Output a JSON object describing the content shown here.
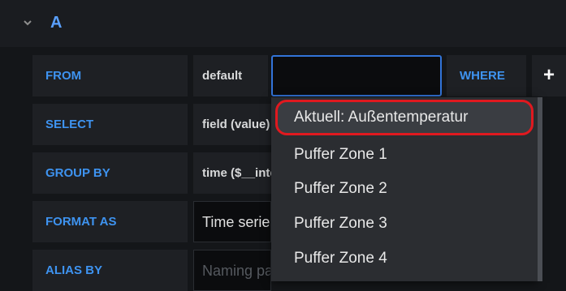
{
  "query": {
    "letter": "A"
  },
  "rows": {
    "from": {
      "label": "FROM",
      "policy": "default",
      "measurement_value": "",
      "where_label": "WHERE",
      "add_label": "+"
    },
    "select": {
      "label": "SELECT",
      "field": "field (value)"
    },
    "group_by": {
      "label": "GROUP BY",
      "time": "time ($__interval)"
    },
    "format_as": {
      "label": "FORMAT AS",
      "value": "Time series"
    },
    "alias_by": {
      "label": "ALIAS BY",
      "placeholder": "Naming pattern"
    }
  },
  "dropdown": {
    "items": [
      {
        "label": "Aktuell: Außentemperatur",
        "highlighted": true
      },
      {
        "label": "Puffer Zone 1"
      },
      {
        "label": "Puffer Zone 2"
      },
      {
        "label": "Puffer Zone 3"
      },
      {
        "label": "Puffer Zone 4"
      }
    ]
  },
  "colors": {
    "accent": "#3e93f0",
    "highlight_border": "#e0191f",
    "background": "#141619",
    "panel": "#1e2024"
  },
  "icons": {
    "collapse": "chevron-down-icon",
    "add": "plus-icon"
  }
}
